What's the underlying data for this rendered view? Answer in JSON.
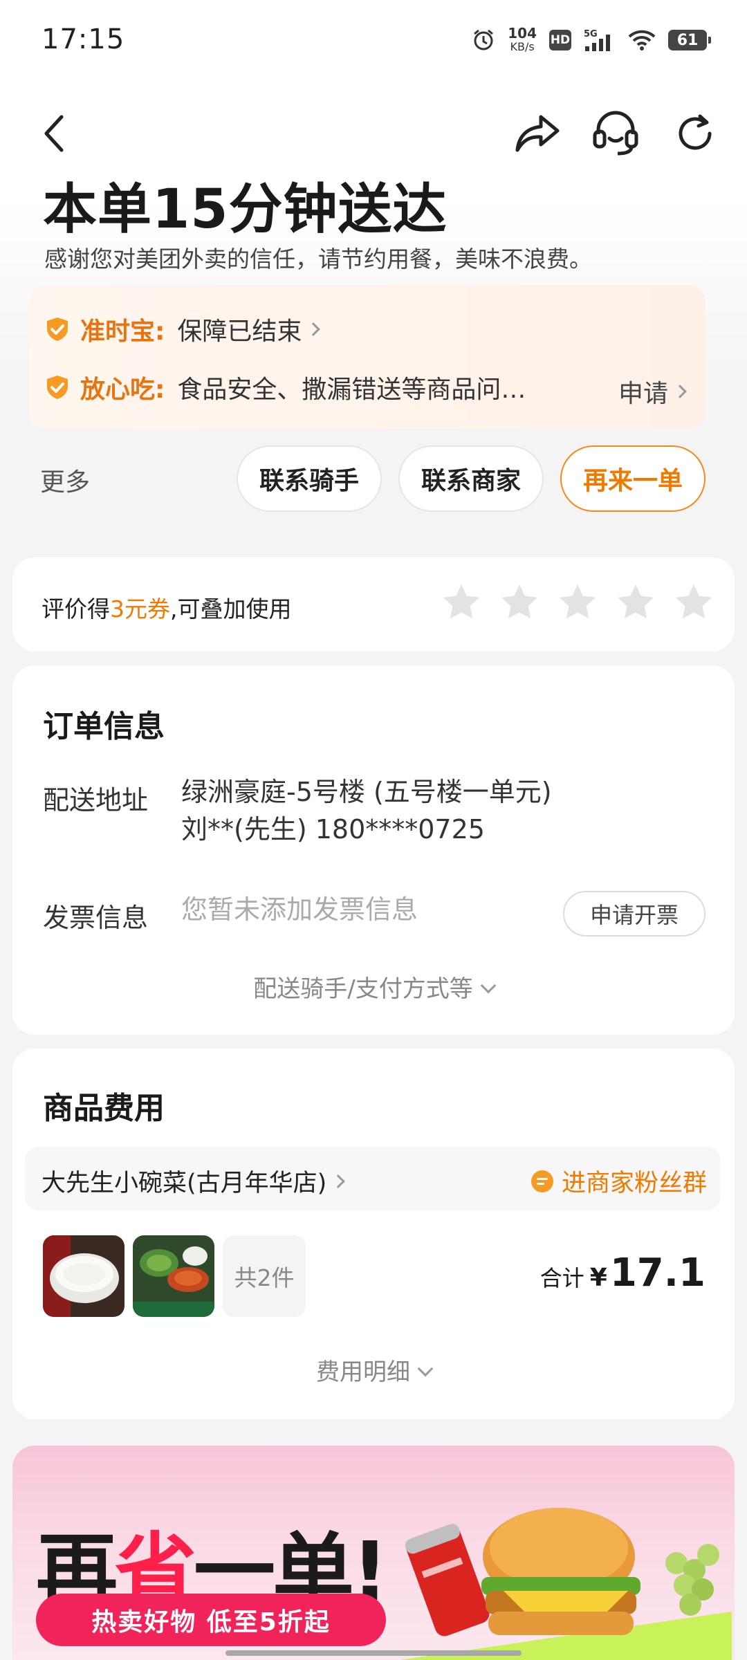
{
  "status": {
    "time": "17:15",
    "speed_value": "104",
    "speed_unit": "KB/s",
    "hd": "HD",
    "network": "5G",
    "battery": "61"
  },
  "header": {
    "title": "本单15分钟送达",
    "subtitle": "感谢您对美团外卖的信任，请节约用餐，美味不浪费。"
  },
  "guarantee": {
    "ontime_label": "准时宝:",
    "ontime_text": "保障已结束",
    "safe_label": "放心吃:",
    "safe_text": "食品安全、撒漏错送等商品问…",
    "apply_label": "申请"
  },
  "actions": {
    "more": "更多",
    "contact_rider": "联系骑手",
    "contact_merchant": "联系商家",
    "reorder": "再来一单"
  },
  "rating": {
    "prefix": "评价得",
    "highlight": "3元券",
    "suffix": ",可叠加使用",
    "stars": 5
  },
  "order_info": {
    "title": "订单信息",
    "address_label": "配送地址",
    "address_line1": "绿洲豪庭-5号楼 (五号楼一单元)",
    "address_line2": "刘**(先生) 180****0725",
    "invoice_label": "发票信息",
    "invoice_placeholder": "您暂未添加发票信息",
    "invoice_button": "申请开票",
    "expand_text": "配送骑手/支付方式等"
  },
  "goods": {
    "title": "商品费用",
    "shop_name": "大先生小碗菜(古月年华店)",
    "fans_group": "进商家粉丝群",
    "item_count": "共2件",
    "total_label": "合计",
    "currency": "¥",
    "total_amount": "17.1",
    "detail_text": "费用明细"
  },
  "banner": {
    "title_part1": "再",
    "title_part2": "省",
    "title_part3": "一单!",
    "promo": "热卖好物 低至5折起"
  },
  "colors": {
    "accent": "#f07a00",
    "banner_red": "#ff1f4b",
    "banner_pill": "#f0245a"
  }
}
